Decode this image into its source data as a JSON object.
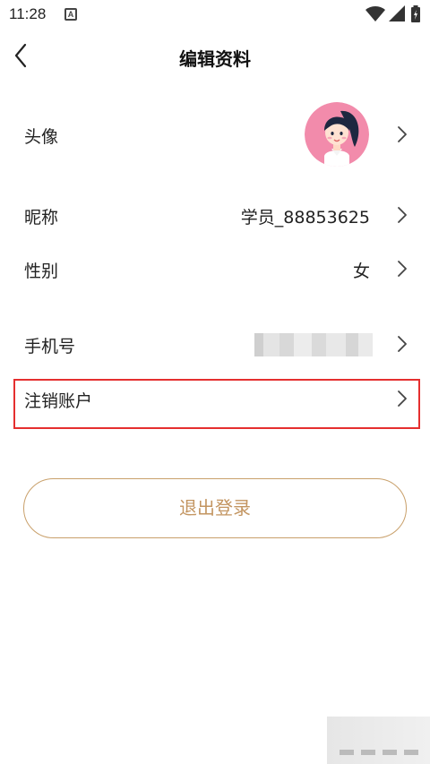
{
  "status_bar": {
    "time": "11:28",
    "notification_icon_letter": "A",
    "icons": [
      "wifi-icon",
      "signal-icon",
      "battery-icon"
    ]
  },
  "header": {
    "title": "编辑资料",
    "back_icon": "chevron-left-icon"
  },
  "rows": [
    {
      "label": "头像",
      "value": "",
      "type": "avatar"
    },
    {
      "label": "昵称",
      "value": "学员_88853625"
    },
    {
      "label": "性别",
      "value": "女"
    },
    {
      "label": "手机号",
      "value": "",
      "type": "masked"
    },
    {
      "label": "注销账户",
      "value": "",
      "highlighted": true
    }
  ],
  "logout_button": {
    "label": "退出登录"
  },
  "colors": {
    "accent": "#c39561",
    "accent_border": "#c9a06b",
    "highlight": "#e52f2f",
    "avatar_bg": "#f28bab"
  }
}
